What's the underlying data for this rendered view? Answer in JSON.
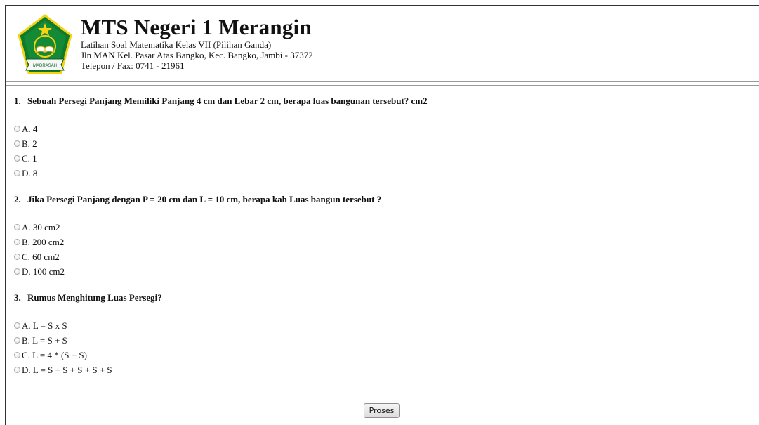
{
  "header": {
    "title": "MTS Negeri 1 Merangin",
    "line1": "Latihan Soal Matematika Kelas VII (Pilihan Ganda)",
    "line2": "Jln MAN Kel. Pasar Atas Bangko, Kec. Bangko, Jambi - 37372",
    "line3": "Telepon / Fax: 0741 - 21961",
    "logo_text": "MADRASAH",
    "colors": {
      "logo_green": "#0f7a2c",
      "logo_yellow": "#f5d311"
    }
  },
  "questions": [
    {
      "number": "1.",
      "text": "Sebuah Persegi Panjang Memiliki Panjang 4 cm dan Lebar 2 cm, berapa luas bangunan tersebut? cm2",
      "options": [
        "A. 4",
        "B. 2",
        "C. 1",
        "D. 8"
      ]
    },
    {
      "number": "2.",
      "text": "Jika Persegi Panjang dengan P = 20 cm dan L = 10 cm, berapa kah Luas bangun tersebut ?",
      "options": [
        "A. 30 cm2",
        "B. 200 cm2",
        "C. 60 cm2",
        "D. 100 cm2"
      ]
    },
    {
      "number": "3.",
      "text": "Rumus Menghitung Luas Persegi?",
      "options": [
        "A. L = S x S",
        "B. L = S + S",
        "C. L = 4 * (S + S)",
        "D. L = S + S + S + S + S"
      ]
    }
  ],
  "submit": {
    "label": "Proses"
  }
}
